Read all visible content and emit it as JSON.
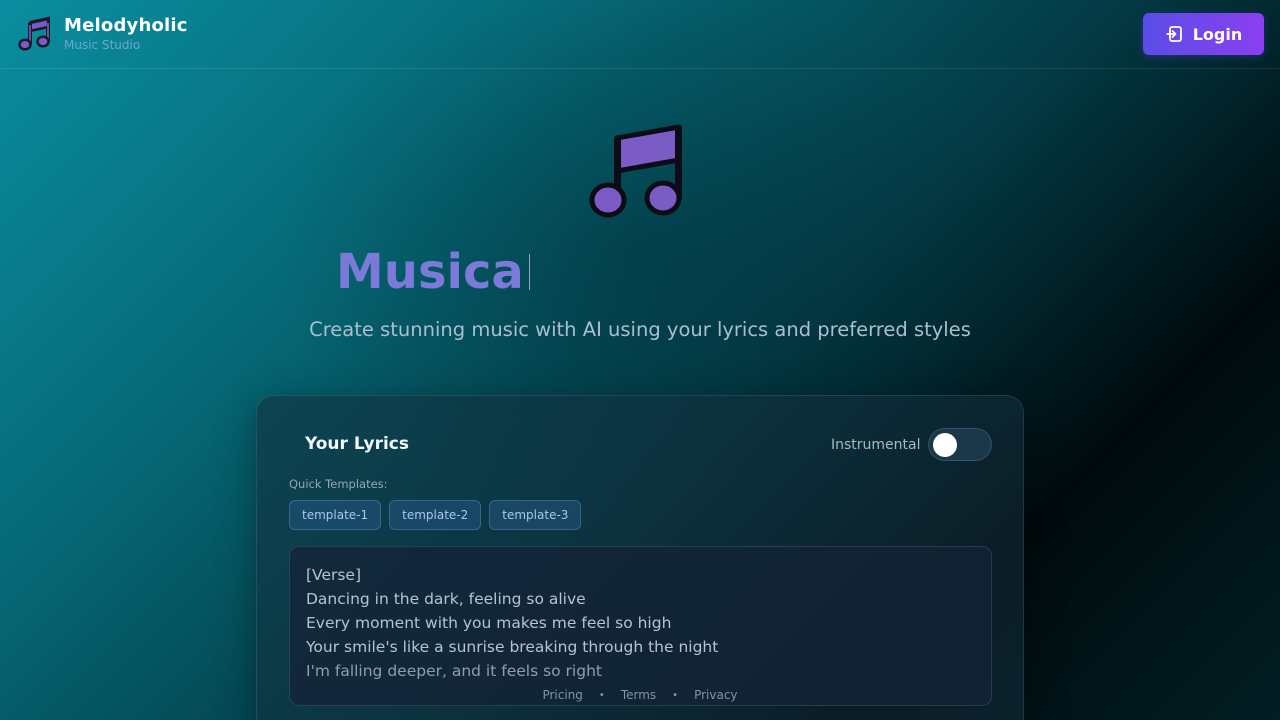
{
  "header": {
    "brand_title": "Melodyholic",
    "brand_subtitle": "Music Studio",
    "login_label": "Login"
  },
  "hero": {
    "title": "Musica",
    "subtitle": "Create stunning music with AI using your lyrics and preferred styles"
  },
  "card": {
    "title": "Your Lyrics",
    "instrumental_label": "Instrumental",
    "instrumental_on": false,
    "quick_templates_label": "Quick Templates:",
    "templates": [
      "template-1",
      "template-2",
      "template-3"
    ],
    "lyrics_lines": [
      "[Verse]",
      "Dancing in the dark, feeling so alive",
      "Every moment with you makes me feel so high",
      "Your smile's like a sunrise breaking through the night",
      "I'm falling deeper, and it feels so right"
    ]
  },
  "footer": {
    "links": [
      "Pricing",
      "Terms",
      "Privacy"
    ]
  },
  "colors": {
    "accent_gradient_start": "#5b4de6",
    "accent_gradient_end": "#8a3ff0",
    "note_purple": "#7b5bc4",
    "title_color": "#7b7ad8"
  },
  "icons": {
    "brand": "music-note-icon",
    "login": "login-icon",
    "hero": "music-note-icon"
  }
}
